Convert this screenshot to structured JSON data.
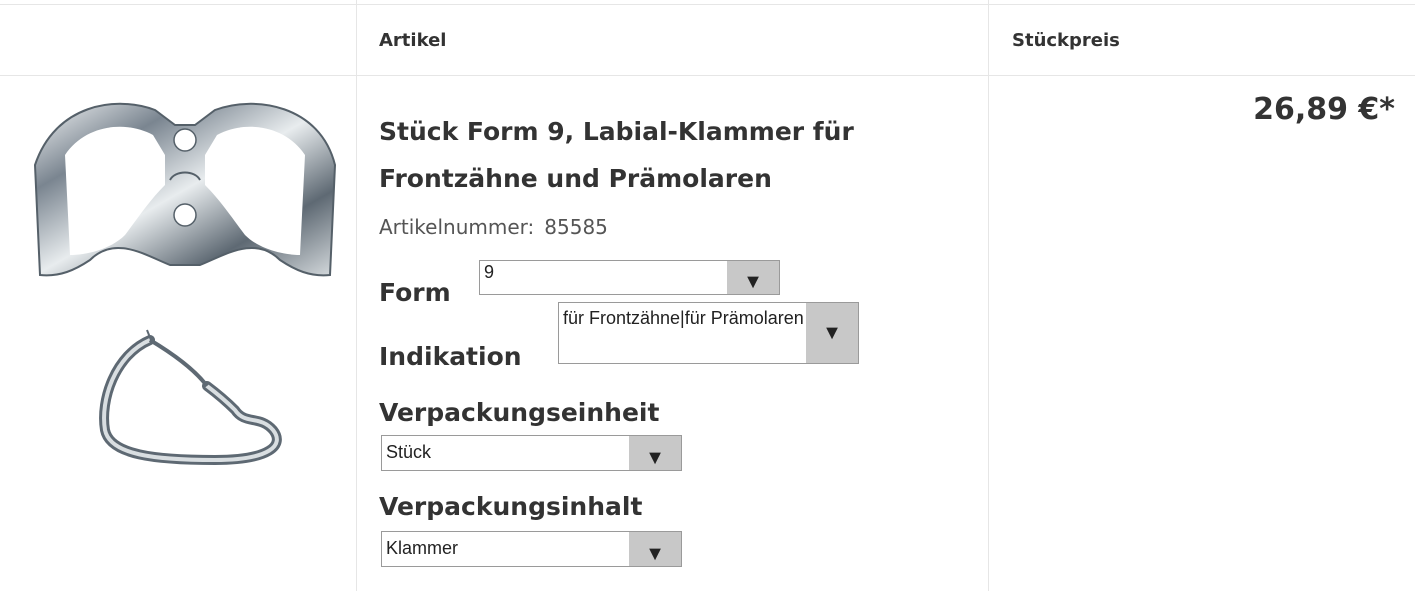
{
  "table": {
    "headers": {
      "article": "Artikel",
      "unit_price": "Stückpreis"
    }
  },
  "product": {
    "title": "Stück Form 9, Labial-Klammer für Frontzähne und Prämolaren",
    "article_number_label": "Artikelnummer:",
    "article_number": "85585",
    "price": "26,89 €*",
    "images": [
      "clamp-top-view",
      "clamp-side-view"
    ]
  },
  "options": {
    "form": {
      "label": "Form",
      "value": "9"
    },
    "indikation": {
      "label": "Indikation",
      "value": "für Frontzähne|für Prämolaren"
    },
    "verpackungseinheit": {
      "label": "Verpackungseinheit",
      "value": "Stück"
    },
    "verpackungsinhalt": {
      "label": "Verpackungsinhalt",
      "value": "Klammer"
    }
  },
  "icons": {
    "dropdown": "triangle-down-icon"
  },
  "colors": {
    "text": "#333333",
    "border": "#e6e6e6",
    "select_arrow_bg": "#c8c8c8"
  }
}
